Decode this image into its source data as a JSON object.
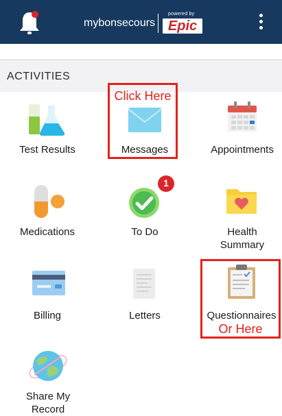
{
  "header": {
    "brand": "mybonsecours",
    "powered_by": "powered by",
    "epic": "Epic",
    "notification_icon": "bell-icon",
    "menu_icon": "kebab-menu-icon"
  },
  "section": {
    "title": "ACTIVITIES"
  },
  "activities": [
    {
      "label": "Test Results",
      "icon": "test-tubes-icon"
    },
    {
      "label": "Messages",
      "icon": "envelope-icon"
    },
    {
      "label": "Appointments",
      "icon": "calendar-icon"
    },
    {
      "label": "Medications",
      "icon": "pill-icon"
    },
    {
      "label": "To Do",
      "icon": "checkmark-clock-icon",
      "badge": "1"
    },
    {
      "label": "Health",
      "label2": "Summary",
      "icon": "folder-heart-icon"
    },
    {
      "label": "Billing",
      "icon": "credit-card-icon"
    },
    {
      "label": "Letters",
      "icon": "document-icon"
    },
    {
      "label": "Questionnaires",
      "icon": "clipboard-icon"
    },
    {
      "label": "Share My",
      "label2": "Record",
      "icon": "globe-icon"
    }
  ],
  "annotations": {
    "click_here": "Click Here",
    "or_here": "Or Here"
  },
  "colors": {
    "header_bg": "#17395f",
    "annotation_red": "#e2231a",
    "badge_red": "#d9262b"
  }
}
